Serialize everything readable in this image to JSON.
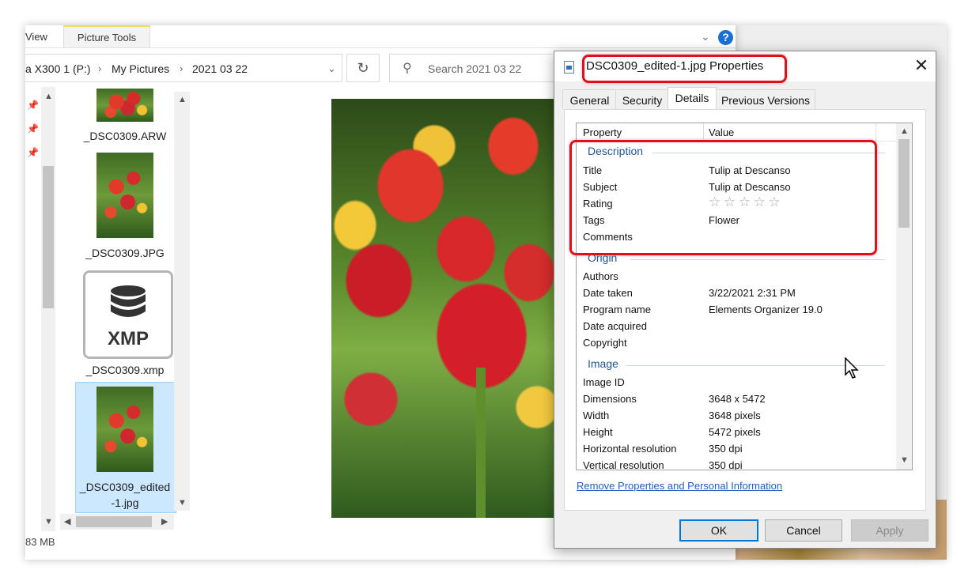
{
  "explorer": {
    "ribbon": {
      "view_tab": "View",
      "picture_tools_tab": "Picture Tools",
      "help": "?"
    },
    "address": {
      "drive": "a X300 1 (P:)",
      "folder1": "My Pictures",
      "folder2": "2021 03 22"
    },
    "search": {
      "placeholder": "Search 2021 03 22"
    },
    "files": [
      {
        "name": "_DSC0309.ARW"
      },
      {
        "name": "_DSC0309.JPG"
      },
      {
        "name": "_DSC0309.xmp",
        "icon_label": "XMP"
      },
      {
        "name_line1": "_DSC0309_edited",
        "name_line2": "-1.jpg"
      }
    ],
    "status": "83 MB"
  },
  "dialog": {
    "title": "DSC0309_edited-1.jpg Properties",
    "tabs": [
      "General",
      "Security",
      "Details",
      "Previous Versions"
    ],
    "active_tab": "Details",
    "columns": {
      "property": "Property",
      "value": "Value"
    },
    "sections": {
      "description": {
        "label": "Description",
        "rows": [
          {
            "name": "Title",
            "value": "Tulip at Descanso"
          },
          {
            "name": "Subject",
            "value": "Tulip at Descanso"
          },
          {
            "name": "Rating",
            "value": ""
          },
          {
            "name": "Tags",
            "value": "Flower"
          },
          {
            "name": "Comments",
            "value": ""
          }
        ],
        "rating_stars": 0
      },
      "origin": {
        "label": "Origin",
        "rows": [
          {
            "name": "Authors",
            "value": ""
          },
          {
            "name": "Date taken",
            "value": "3/22/2021 2:31 PM"
          },
          {
            "name": "Program name",
            "value": "Elements Organizer 19.0"
          },
          {
            "name": "Date acquired",
            "value": ""
          },
          {
            "name": "Copyright",
            "value": ""
          }
        ]
      },
      "image": {
        "label": "Image",
        "rows": [
          {
            "name": "Image ID",
            "value": ""
          },
          {
            "name": "Dimensions",
            "value": "3648 x 5472"
          },
          {
            "name": "Width",
            "value": "3648 pixels"
          },
          {
            "name": "Height",
            "value": "5472 pixels"
          },
          {
            "name": "Horizontal resolution",
            "value": "350 dpi"
          },
          {
            "name": "Vertical resolution",
            "value": "350 dpi"
          }
        ]
      }
    },
    "remove_link": "Remove Properties and Personal Information",
    "buttons": {
      "ok": "OK",
      "cancel": "Cancel",
      "apply": "Apply"
    }
  },
  "colors": {
    "highlight_box": "#e0101a",
    "section_text": "#1f55a0",
    "selection": "#cce8ff",
    "link": "#1f5fc4"
  },
  "icons": [
    "pin-icon",
    "refresh-icon",
    "search-icon",
    "database-icon",
    "file-icon",
    "close-icon",
    "star-icon",
    "chevron-down-icon",
    "help-icon",
    "mouse-cursor-icon"
  ]
}
